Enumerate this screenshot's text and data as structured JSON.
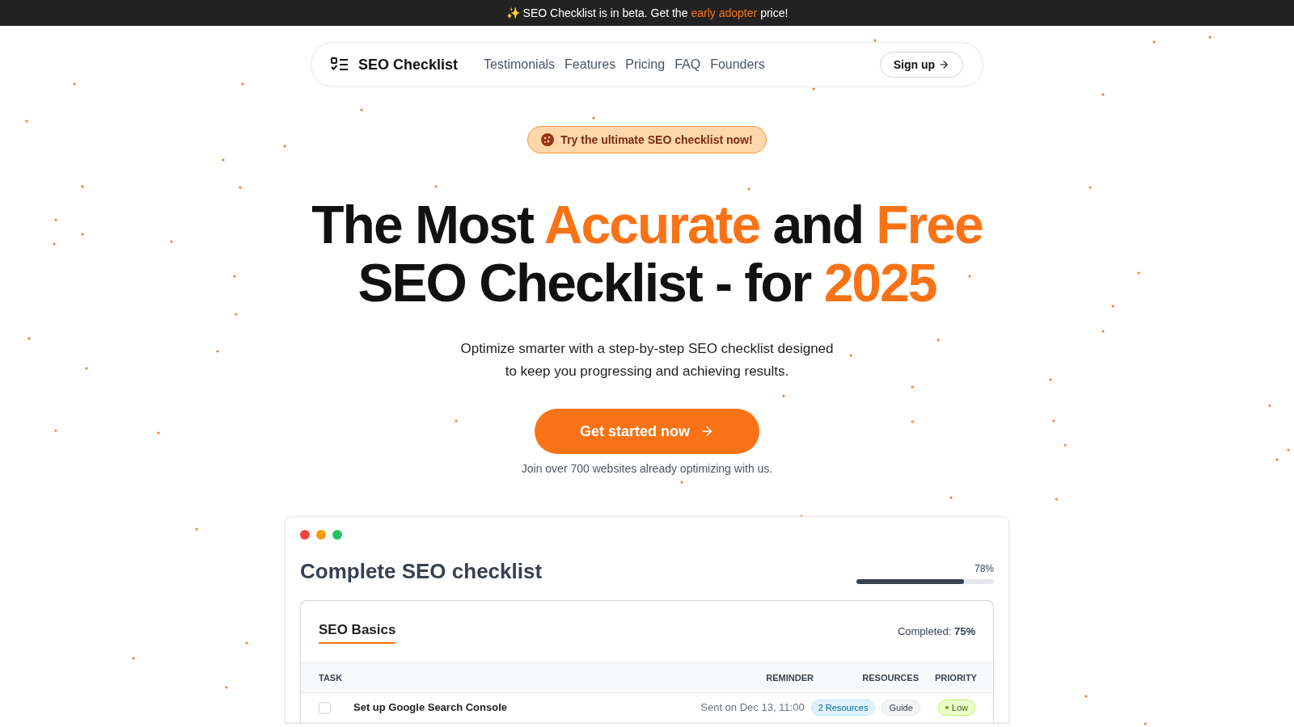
{
  "announcement": {
    "icon": "✨",
    "text": "SEO Checklist is in beta. Get the",
    "link": "early adopter",
    "suffix": "price!"
  },
  "nav": {
    "logo": "SEO Checklist",
    "links": [
      "Testimonials",
      "Features",
      "Pricing",
      "FAQ",
      "Founders"
    ],
    "signup": "Sign up"
  },
  "badge": "Try the ultimate SEO checklist now!",
  "headline": [
    [
      {
        "text": "The Most ",
        "accent": false
      },
      {
        "text": "Accurate",
        "accent": true
      },
      {
        "text": " and ",
        "accent": false
      },
      {
        "text": "Free",
        "accent": true
      }
    ],
    [
      {
        "text": "SEO Checklist - for ",
        "accent": false
      },
      {
        "text": "2025",
        "accent": true
      }
    ]
  ],
  "subtitle": "Optimize smarter with a step-by-step SEO checklist designed to keep you progressing and achieving results.",
  "cta": "Get started now",
  "social_proof": "Join over 700 websites already optimizing with us.",
  "preview": {
    "title": "Complete SEO checklist",
    "progress": {
      "reading": "78%",
      "level": 0.78
    },
    "section": {
      "tab": "SEO Basics",
      "completed": "Completed: **75%**",
      "columns": [
        "TASK",
        "REMINDER",
        "RESOURCES",
        "PRIORITY"
      ],
      "rows": [
        {
          "checked": false,
          "task": "Set up Google Search Console",
          "reminder": "Sent on Dec 13, 11:00",
          "resources": [
            {
              "label": "2 Resources",
              "kind": "link"
            },
            {
              "label": "Guide",
              "kind": "plain"
            }
          ],
          "priority": {
            "label": "Low",
            "kind": "low"
          }
        }
      ]
    }
  }
}
